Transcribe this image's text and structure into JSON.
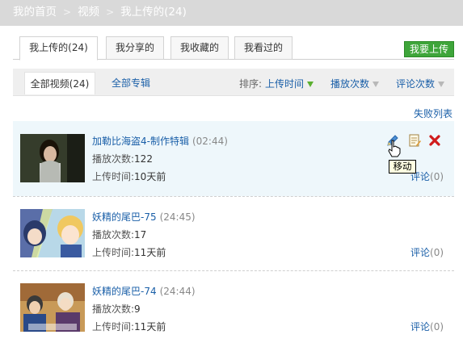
{
  "breadcrumb": {
    "home": "我的首页",
    "section": "视频",
    "current": "我上传的(24)",
    "separator": ">"
  },
  "tabs": [
    {
      "label": "我上传的(24)"
    },
    {
      "label": "我分享的"
    },
    {
      "label": "我收藏的"
    },
    {
      "label": "我看过的"
    }
  ],
  "upload_button": "我要上传",
  "subtabs": {
    "all": "全部视频(24)",
    "albums": "全部专辑"
  },
  "sort": {
    "label": "排序:",
    "upload_time": "上传时间",
    "play_count": "播放次数",
    "comments": "评论次数"
  },
  "fail_list": "失败列表",
  "labels": {
    "plays": "播放次数:",
    "uploaded": "上传时间:"
  },
  "videos": [
    {
      "title": "加勒比海盗4-制作特辑",
      "duration": "(02:44)",
      "plays": "122",
      "uploaded": "10天前",
      "comment_label": "评论",
      "comment_count": "(0)"
    },
    {
      "title": "妖精的尾巴-75",
      "duration": "(24:45)",
      "plays": "17",
      "uploaded": "11天前",
      "comment_label": "评论",
      "comment_count": "(0)"
    },
    {
      "title": "妖精的尾巴-74",
      "duration": "(24:44)",
      "plays": "9",
      "uploaded": "11天前",
      "comment_label": "评论",
      "comment_count": "(0)"
    }
  ],
  "tooltip": "移动",
  "colors": {
    "link": "#1a5fa8",
    "upload_green": "#3ea53a",
    "highlight_row": "#eef7fb",
    "delete_red": "#d01c1c"
  }
}
